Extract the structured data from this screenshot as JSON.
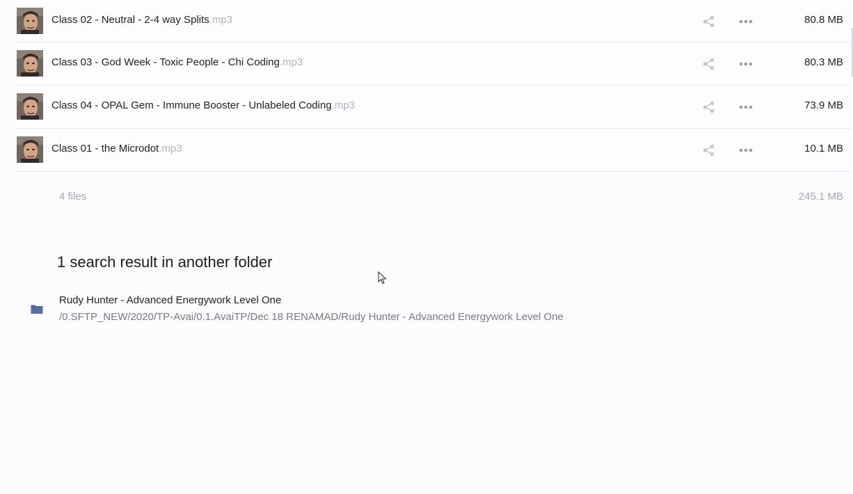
{
  "files": [
    {
      "name": "Class 02 - Neutral - 2-4 way Splits",
      "ext": ".mp3",
      "size": "80.8 MB",
      "icon": "avatar-thumbnail"
    },
    {
      "name": "Class 03 - God Week - Toxic People - Chi Coding",
      "ext": ".mp3",
      "size": "80.3 MB",
      "icon": "avatar-thumbnail"
    },
    {
      "name": "Class 04 - OPAL Gem - Immune Booster - Unlabeled Coding",
      "ext": ".mp3",
      "size": "73.9 MB",
      "icon": "avatar-thumbnail"
    },
    {
      "name": "Class 01 - the Microdot",
      "ext": ".mp3",
      "size": "10.1 MB",
      "icon": "avatar-thumbnail"
    }
  ],
  "summary": {
    "count": "4 files",
    "total_size": "245.1 MB"
  },
  "other_results": {
    "title": "1 search result in another folder",
    "folder": {
      "name": "Rudy Hunter - Advanced Energywork Level One",
      "path": "/0.SFTP_NEW/2020/TP-Avai/0.1.AvaiTP/Dec 18 RENAMAD/Rudy Hunter - Advanced Energywork Level One",
      "icon": "folder-icon"
    }
  },
  "colors": {
    "background": "#fcfbfd",
    "folder_icon": "#4a6296",
    "action_icon": "#c9c7cc",
    "muted_text": "#a8a6ab"
  }
}
